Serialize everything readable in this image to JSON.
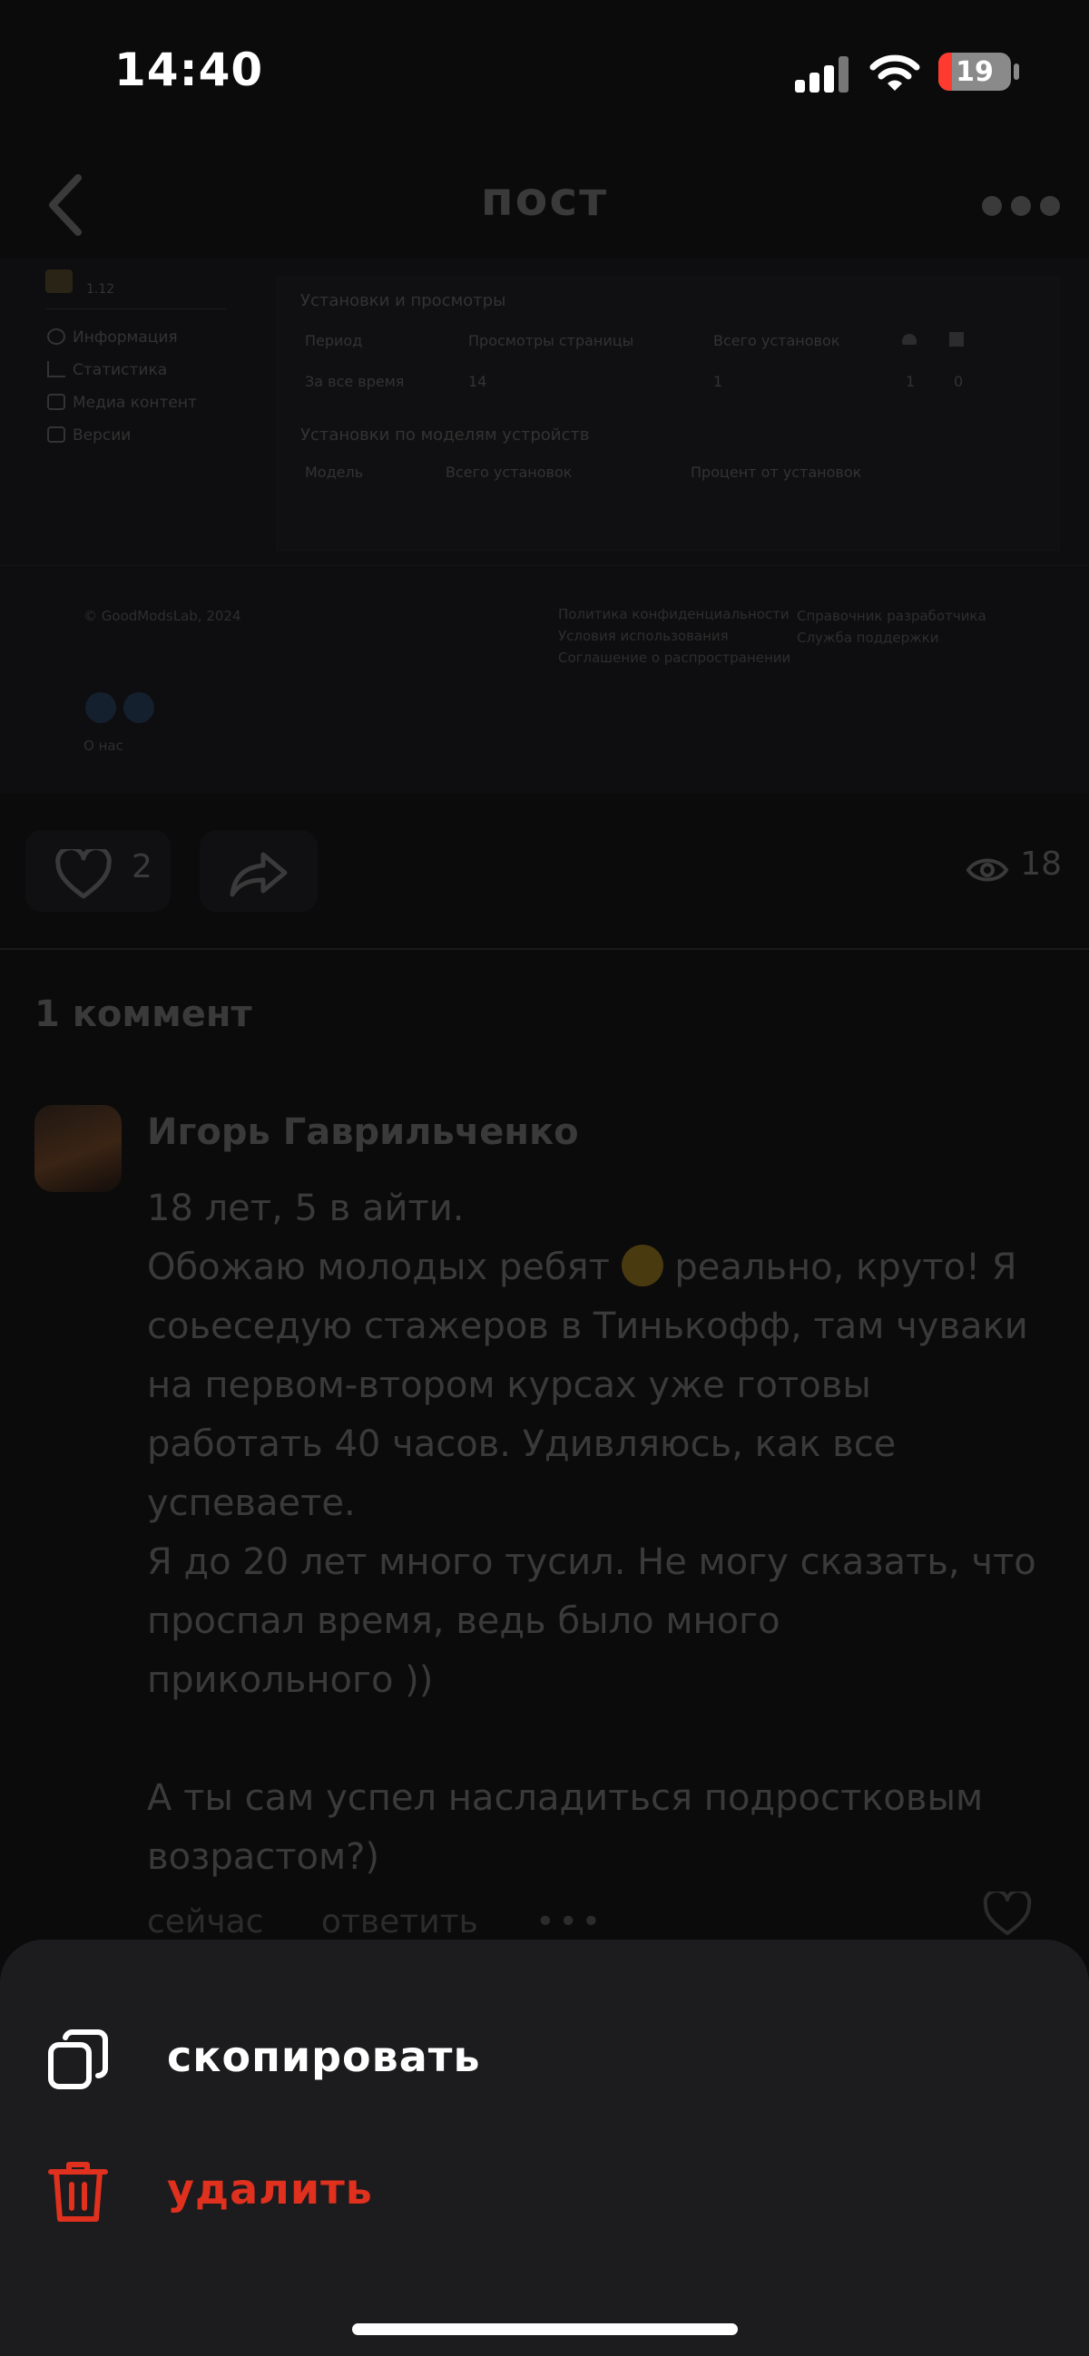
{
  "status_bar": {
    "time": "14:40",
    "battery": "19"
  },
  "nav": {
    "title": "пост"
  },
  "post_screenshot": {
    "sidebar": {
      "version": "1.12",
      "items": [
        "Информация",
        "Статистика",
        "Медиа контент",
        "Версии"
      ]
    },
    "installs_section": {
      "title": "Установки и просмотры",
      "headers": [
        "Период",
        "Просмотры страницы",
        "Всего установок"
      ],
      "row": {
        "period": "За все время",
        "views": "14",
        "installs": "1",
        "android": "1",
        "windows": "0"
      }
    },
    "models_section": {
      "title": "Установки по моделям устройств",
      "headers": [
        "Модель",
        "Всего установок",
        "Процент от установок"
      ]
    },
    "footer": {
      "copyright": "© GoodModsLab, 2024",
      "links_col1": [
        "Политика конфиденциальности",
        "Условия использования",
        "Соглашение о распространении"
      ],
      "links_col2": [
        "Справочник разработчика",
        "Служба поддержки"
      ],
      "about": "О нас"
    }
  },
  "post_actions": {
    "likes": "2",
    "views": "18"
  },
  "comments": {
    "count_label": "1 коммент",
    "items": [
      {
        "author": "Игорь Гаврильченко",
        "lines": [
          "18 лет, 5 в айти.",
          "Обожаю молодых ребят",
          "реально, круто! Я",
          "соьеседую стажеров в Тинькофф, там чуваки",
          "на первом-втором курсах уже готовы",
          "работать 40 часов. Удивляюсь, как все",
          "успеваете.",
          "Я до 20 лет много тусил. Не могу сказать, что",
          "проспал время, ведь было много",
          "прикольного ))",
          "А ты сам успел насладиться подростковым",
          "возрастом?)"
        ],
        "time": "сейчас",
        "reply_label": "ответить"
      }
    ]
  },
  "sheet": {
    "copy_label": "скопировать",
    "delete_label": "удалить",
    "delete_color": "#e0301e"
  }
}
